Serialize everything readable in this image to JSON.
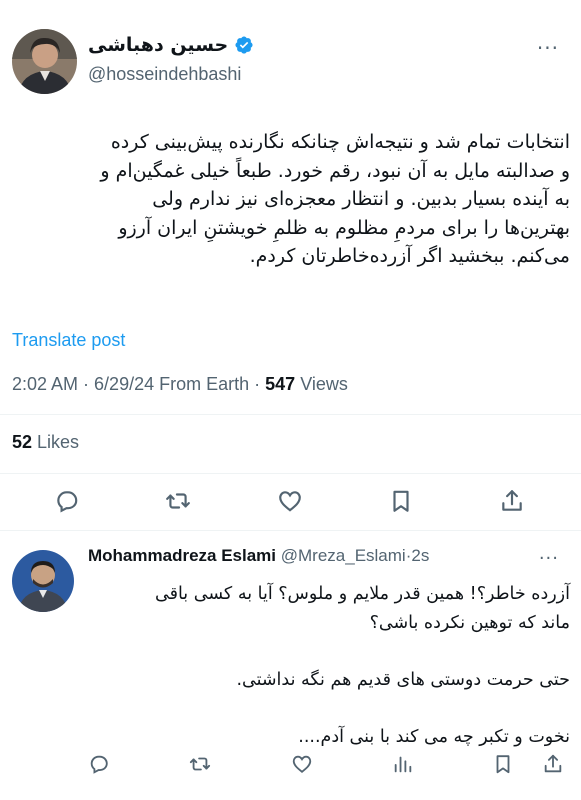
{
  "tweet": {
    "display_name": "حسین دهباشی",
    "handle": "@hosseindehbashi",
    "more_label": "···",
    "body_lines": [
      "انتخابات تمام شد و نتیجه‌اش چنانکه نگارنده پیش‌بینی کرده",
      "و صدالبته مایل به آن نبود، رقم خورد. طبعاً خیلی غمگین‌ام و",
      "به آینده بسیار بدبین. و انتظار معجزه‌ای نیز ندارم ولی",
      "بهترین‌ها را برای مردمِ مظلوم به ظلمِ خویشتنِ ایران آرزو",
      "می‌کنم. ببخشید اگر آزرده‌خاطرتان کردم."
    ],
    "translate_label": "Translate post",
    "time": "2:02 AM",
    "sep1": " · ",
    "date": "6/29/24",
    "source": " From Earth",
    "sep2": " · ",
    "views_count": "547",
    "views_label": " Views",
    "likes_count": "52",
    "likes_label": " Likes"
  },
  "reply": {
    "display_name": "Mohammadreza Eslami",
    "handle": "@Mreza_Eslami",
    "sep": "·",
    "time": "2s",
    "more_label": "···",
    "body_lines": [
      "آزرده خاطر؟! همین قدر ملایم و ملوس؟ آیا به کسی باقی",
      "ماند که توهین نکرده باشی؟",
      "",
      "حتی حرمت دوستی های قدیم هم نگه نداشتی.",
      "",
      "نخوت و تکبر چه می کند با بنی آدم...."
    ]
  },
  "icons": {
    "verified": "verified-badge-icon",
    "reply": "reply-icon",
    "retweet": "retweet-icon",
    "like": "like-icon",
    "bookmark": "bookmark-icon",
    "share": "share-icon",
    "views": "views-icon"
  },
  "colors": {
    "accent": "#1d9bf0",
    "muted": "#536471",
    "text": "#0f1419",
    "divider": "#eff3f4"
  }
}
